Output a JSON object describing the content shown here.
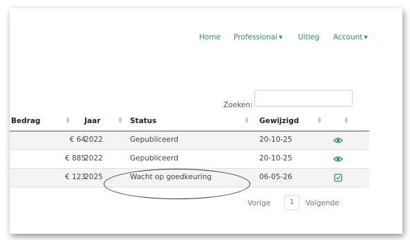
{
  "nav": {
    "home": "Home",
    "professional": "Professional",
    "uitleg": "Uitleg",
    "account": "Account"
  },
  "search": {
    "label": "Zoeken:",
    "value": ""
  },
  "table": {
    "headers": {
      "bedrag": "Bedrag",
      "jaar": "Jaar",
      "status": "Status",
      "gewijzigd": "Gewijzigd"
    },
    "rows": [
      {
        "bedrag": "€ 64",
        "jaar": "2022",
        "status": "Gepubliceerd",
        "gewijzigd": "20-10-25",
        "action_icon": "eye-icon"
      },
      {
        "bedrag": "€ 885",
        "jaar": "2022",
        "status": "Gepubliceerd",
        "gewijzigd": "20-10-25",
        "action_icon": "eye-icon"
      },
      {
        "bedrag": "€ 123",
        "jaar": "2025",
        "status": "Wacht op goedkeuring",
        "gewijzigd": "06-05-26",
        "action_icon": "edit-check-icon"
      }
    ]
  },
  "pagination": {
    "previous": "Vorige",
    "current_page": "1",
    "next": "Volgende"
  },
  "colors": {
    "accent": "#2f8f61"
  }
}
